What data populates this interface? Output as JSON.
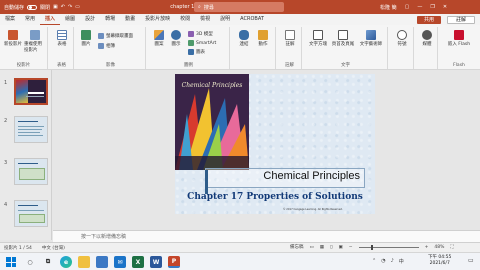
{
  "titlebar": {
    "autosave_label": "自動儲存",
    "autosave_state": "關閉",
    "doc_title": "chapter 17",
    "search_placeholder": "搜尋",
    "user_name": "松隆 簡",
    "icons": [
      "save-icon",
      "undo-icon",
      "redo-icon",
      "present-icon",
      "minimize-icon",
      "restore-icon",
      "close-icon"
    ]
  },
  "tabs": [
    "檔案",
    "常用",
    "插入",
    "繪圖",
    "設計",
    "轉場",
    "動畫",
    "投影片放映",
    "校閱",
    "檢視",
    "說明",
    "ACROBAT"
  ],
  "active_tab": "插入",
  "share_label": "共用",
  "comment_label": "註解",
  "ribbon": {
    "groups": [
      {
        "label": "投影片",
        "buttons": [
          "新投影片",
          "重複使用投影片"
        ]
      },
      {
        "label": "表格",
        "buttons": [
          "表格"
        ]
      },
      {
        "label": "影像",
        "buttons": [
          "圖片",
          "螢幕擷取畫面",
          "相簿"
        ]
      },
      {
        "label": "圖例",
        "buttons": [
          "圖案",
          "圖示",
          "3D 模型",
          "SmartArt",
          "圖表"
        ]
      },
      {
        "label": "",
        "buttons": [
          "連結",
          "動作"
        ]
      },
      {
        "label": "註解",
        "buttons": [
          "註解"
        ]
      },
      {
        "label": "文字",
        "buttons": [
          "文字方塊",
          "頁首及頁尾",
          "文字藝術師"
        ]
      },
      {
        "label": "",
        "buttons": [
          "符號"
        ]
      },
      {
        "label": "",
        "buttons": [
          "媒體"
        ]
      },
      {
        "label": "Flash",
        "buttons": [
          "嵌入 Flash"
        ]
      }
    ]
  },
  "thumbnails": [
    "1",
    "2",
    "3",
    "4"
  ],
  "slide": {
    "book_title": "Chemical Principles",
    "title": "Chemical Principles",
    "subtitle": "Chapter 17 Properties of Solutions",
    "copyright": "© 2017 Cengage Learning. All Rights Reserved."
  },
  "notes_placeholder": "按一下以新增備忘稿",
  "status": {
    "slide_info": "投影片 1 / 54",
    "language": "中文 (台灣)",
    "notes_btn": "備忘稿",
    "zoom": "48%",
    "zoom_fraction": 0.48
  },
  "taskbar": {
    "time": "下午 04:55",
    "date": "2021/6/7",
    "apps": [
      "search-icon",
      "task-view-icon",
      "edge-icon",
      "file-explorer-icon",
      "store-icon",
      "mail-icon",
      "excel-icon",
      "word-icon",
      "powerpoint-icon"
    ]
  },
  "colors": {
    "accent": "#b7472a",
    "subtitle": "#123a78"
  }
}
